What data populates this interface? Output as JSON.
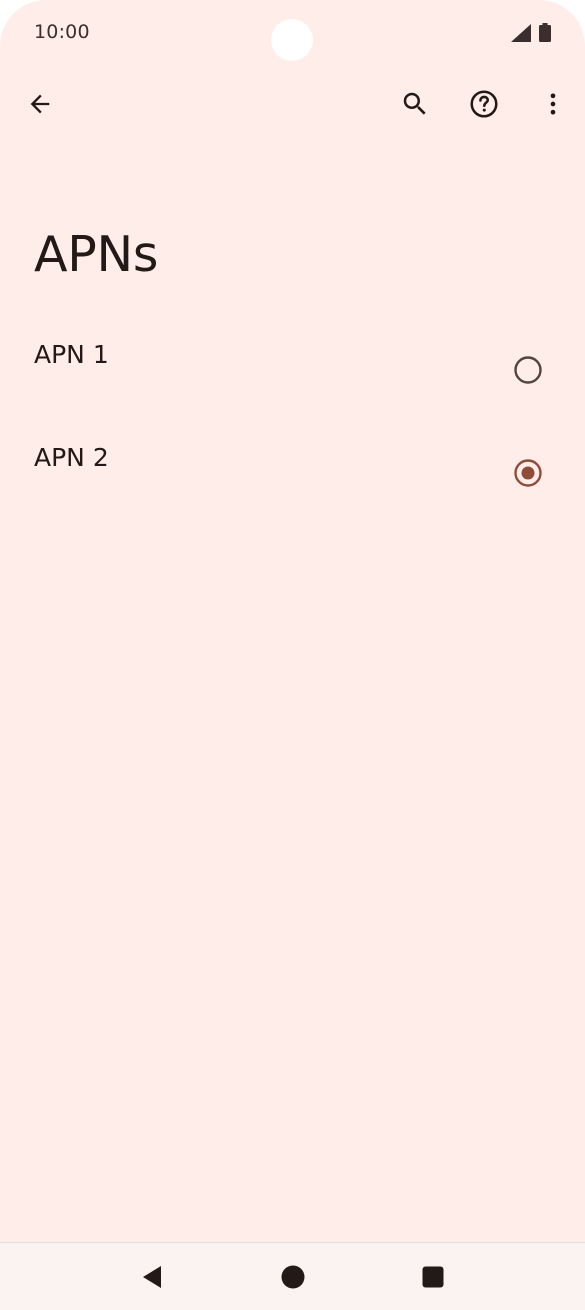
{
  "status_bar": {
    "time": "10:00",
    "icons": [
      "signal-icon",
      "battery-icon"
    ]
  },
  "app_bar": {
    "icons": [
      "back-arrow-icon",
      "search-icon",
      "help-icon",
      "more-vert-icon"
    ]
  },
  "page": {
    "title": "APNs"
  },
  "apn_list": {
    "items": [
      {
        "label": "APN 1",
        "selected": false
      },
      {
        "label": "APN 2",
        "selected": true
      }
    ]
  },
  "nav_bar": {
    "icons": [
      "nav-back-icon",
      "nav-home-icon",
      "nav-recents-icon"
    ]
  },
  "colors": {
    "background": "#ffedea",
    "text": "#231917",
    "radio_selected": "#8f4c38",
    "radio_unselected": "#53433f",
    "nav_background": "#fbf3f2"
  }
}
